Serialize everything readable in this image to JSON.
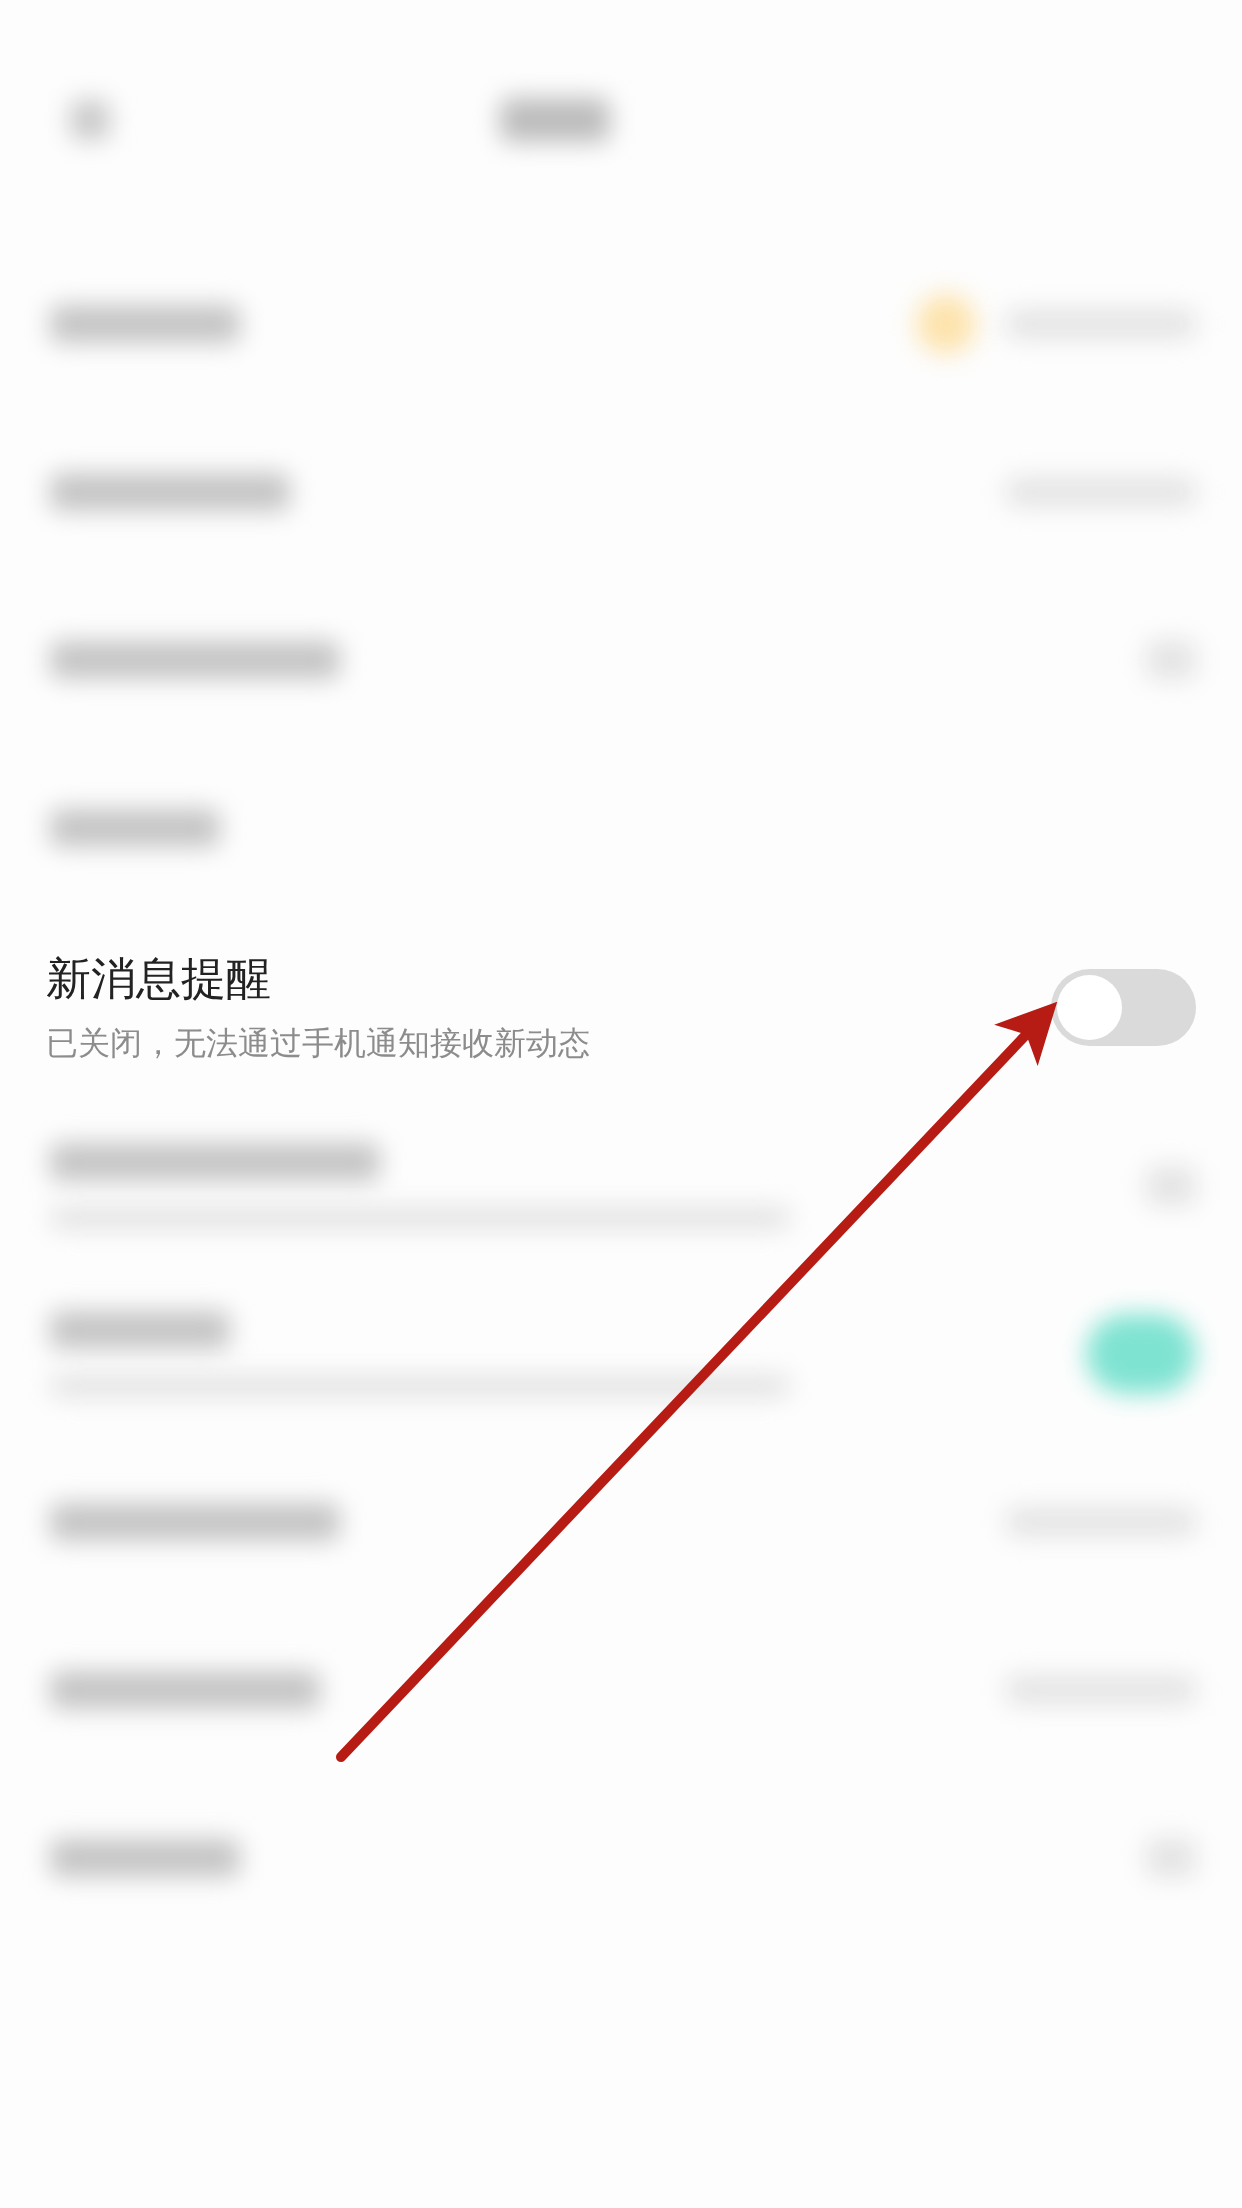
{
  "settings": [
    {
      "kind": "blurred"
    },
    {
      "kind": "blurred"
    },
    {
      "kind": "blurred"
    },
    {
      "kind": "blurred"
    },
    {
      "kind": "toggle",
      "title": "新消息提醒",
      "subtitle": "已关闭，无法通过手机通知接收新动态",
      "on": false
    },
    {
      "kind": "blurred-two-line"
    },
    {
      "kind": "blurred-two-line"
    },
    {
      "kind": "blurred"
    },
    {
      "kind": "blurred"
    },
    {
      "kind": "blurred"
    }
  ],
  "annotation": {
    "kind": "arrow"
  }
}
